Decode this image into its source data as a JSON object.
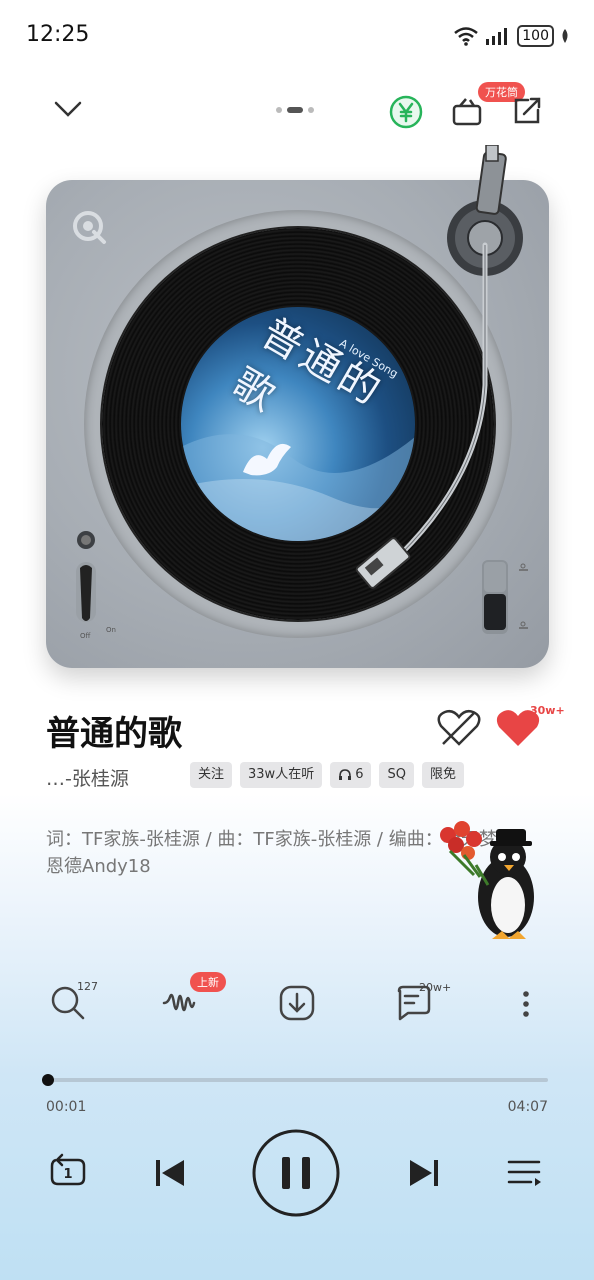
{
  "status_bar": {
    "time": "12:25",
    "battery": "100"
  },
  "header": {
    "badge": "万花筒"
  },
  "album": {
    "art_title": "普通的歌",
    "art_subtitle": "A love Song"
  },
  "song": {
    "title": "普通的歌",
    "artist": "…-张桂源",
    "like_count": "30w+",
    "tags": {
      "follow": "关注",
      "listeners": "33w人在听",
      "headphones": "6",
      "quality": "SQ",
      "free": "限免"
    },
    "credits": "词：TF家族-张桂源 / 曲：TF家族-张桂源 / 编曲：李天梦、恩德Andy18"
  },
  "actions": {
    "search_count": "127",
    "wave_badge": "上新",
    "comment_count": "20w+"
  },
  "playback": {
    "current": "00:01",
    "total": "04:07",
    "progress": 0.004
  },
  "turntable": {
    "switch_off_label": "Off",
    "switch_on_label": "On"
  }
}
